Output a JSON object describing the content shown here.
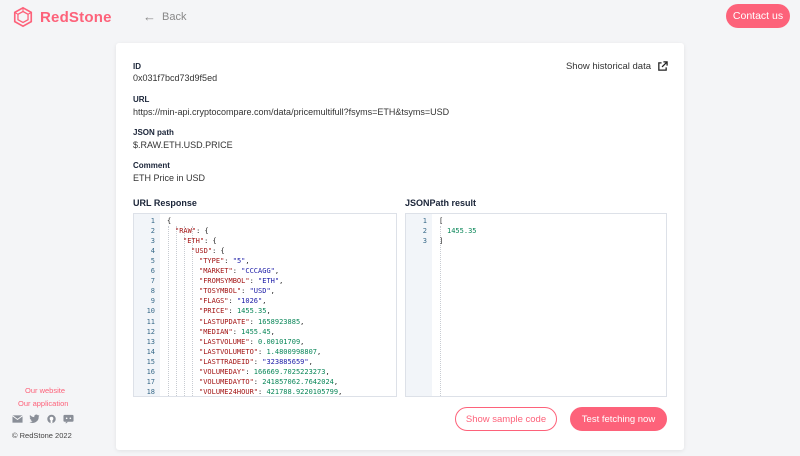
{
  "header": {
    "brand": "RedStone",
    "back_label": "Back",
    "contact_label": "Contact us"
  },
  "sidebar": {
    "links": [
      "Our website",
      "Our application"
    ],
    "social_icons": [
      "mail-icon",
      "twitter-icon",
      "github-icon",
      "discord-icon"
    ],
    "copyright": "© RedStone 2022"
  },
  "details": {
    "id_label": "ID",
    "id_value": "0x031f7bcd73d9f5ed",
    "url_label": "URL",
    "url_value": "https://min-api.cryptocompare.com/data/pricemultifull?fsyms=ETH&tsyms=USD",
    "jsonpath_label": "JSON path",
    "jsonpath_value": "$.RAW.ETH.USD.PRICE",
    "comment_label": "Comment",
    "comment_value": "ETH Price in USD",
    "historical_label": "Show historical data"
  },
  "url_response": {
    "title": "URL Response",
    "lines": [
      {
        "num": "1",
        "depth": 0,
        "key": "",
        "value": "{",
        "type": "p",
        "comma": ""
      },
      {
        "num": "2",
        "depth": 1,
        "key": "\"RAW\"",
        "value": "{",
        "type": "p",
        "comma": ""
      },
      {
        "num": "3",
        "depth": 2,
        "key": "\"ETH\"",
        "value": "{",
        "type": "p",
        "comma": ""
      },
      {
        "num": "4",
        "depth": 3,
        "key": "\"USD\"",
        "value": "{",
        "type": "p",
        "comma": ""
      },
      {
        "num": "5",
        "depth": 4,
        "key": "\"TYPE\"",
        "value": "\"5\"",
        "type": "s",
        "comma": ","
      },
      {
        "num": "6",
        "depth": 4,
        "key": "\"MARKET\"",
        "value": "\"CCCAGG\"",
        "type": "s",
        "comma": ","
      },
      {
        "num": "7",
        "depth": 4,
        "key": "\"FROMSYMBOL\"",
        "value": "\"ETH\"",
        "type": "s",
        "comma": ","
      },
      {
        "num": "8",
        "depth": 4,
        "key": "\"TOSYMBOL\"",
        "value": "\"USD\"",
        "type": "s",
        "comma": ","
      },
      {
        "num": "9",
        "depth": 4,
        "key": "\"FLAGS\"",
        "value": "\"1026\"",
        "type": "s",
        "comma": ","
      },
      {
        "num": "10",
        "depth": 4,
        "key": "\"PRICE\"",
        "value": "1455.35",
        "type": "n",
        "comma": ","
      },
      {
        "num": "11",
        "depth": 4,
        "key": "\"LASTUPDATE\"",
        "value": "1658923885",
        "type": "n",
        "comma": ","
      },
      {
        "num": "12",
        "depth": 4,
        "key": "\"MEDIAN\"",
        "value": "1455.45",
        "type": "n",
        "comma": ","
      },
      {
        "num": "13",
        "depth": 4,
        "key": "\"LASTVOLUME\"",
        "value": "0.00101709",
        "type": "n",
        "comma": ","
      },
      {
        "num": "14",
        "depth": 4,
        "key": "\"LASTVOLUMETO\"",
        "value": "1.4800998807",
        "type": "n",
        "comma": ","
      },
      {
        "num": "15",
        "depth": 4,
        "key": "\"LASTTRADEID\"",
        "value": "\"323885659\"",
        "type": "s",
        "comma": ","
      },
      {
        "num": "16",
        "depth": 4,
        "key": "\"VOLUMEDAY\"",
        "value": "166669.7025223273",
        "type": "n",
        "comma": ","
      },
      {
        "num": "17",
        "depth": 4,
        "key": "\"VOLUMEDAYTO\"",
        "value": "241857062.7642024",
        "type": "n",
        "comma": ","
      },
      {
        "num": "18",
        "depth": 4,
        "key": "\"VOLUME24HOUR\"",
        "value": "421788.9220105799",
        "type": "n",
        "comma": ","
      }
    ]
  },
  "jsonpath_result": {
    "title": "JSONPath result",
    "lines": [
      {
        "num": "1",
        "depth": 0,
        "key": "",
        "value": "[",
        "type": "p",
        "comma": ""
      },
      {
        "num": "2",
        "depth": 1,
        "key": "",
        "value": "1455.35",
        "type": "n",
        "comma": ""
      },
      {
        "num": "3",
        "depth": 0,
        "key": "",
        "value": "]",
        "type": "p",
        "comma": ""
      }
    ]
  },
  "actions": {
    "sample_code_label": "Show sample code",
    "test_fetch_label": "Test fetching now"
  },
  "colors": {
    "accent": "#fd627a",
    "key": "#a31515",
    "string": "#1a1aa6",
    "number": "#098658"
  }
}
